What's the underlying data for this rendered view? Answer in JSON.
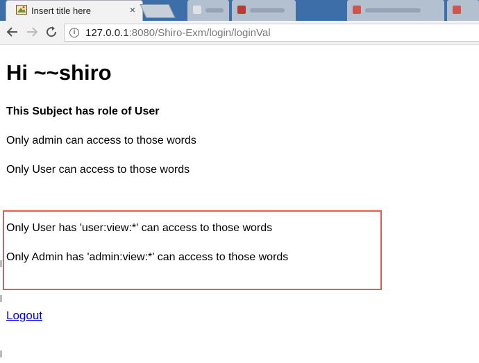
{
  "browser": {
    "active_tab_title": "Insert title here",
    "close_glyph": "×",
    "url_host": "127.0.0.1",
    "url_rest": ":8080/Shiro-Exm/login/loginVal"
  },
  "page": {
    "heading": "Hi ~~shiro",
    "role_line": "This Subject has role of User",
    "admin_words": "Only admin can access to those words",
    "user_words": "Only User can access to those words",
    "user_perm_words": "Only User has 'user:view:*' can access to those words",
    "admin_perm_words": "Only Admin has 'admin:view:*' can access to those words",
    "logout_label": "Logout"
  },
  "colors": {
    "tabbar_bg": "#3d6ea8",
    "highlight_border": "#e35d4f",
    "link": "#0000ee"
  }
}
